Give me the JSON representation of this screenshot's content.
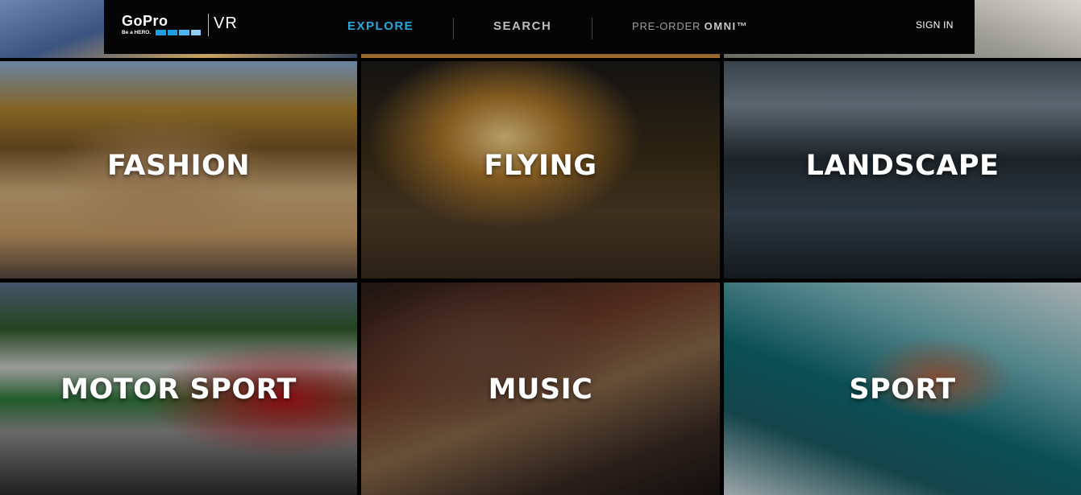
{
  "header": {
    "logo_word": "GoPro",
    "logo_tagline": "Be a HERO.",
    "logo_product": "VR",
    "nav": {
      "explore": "EXPLORE",
      "search": "SEARCH",
      "preorder_prefix": "PRE-ORDER",
      "preorder_product": "OMNI™"
    },
    "sign_in": "SIGN IN",
    "accent_color": "#26a8e0"
  },
  "tiles": [
    {
      "label": "FASHION"
    },
    {
      "label": "FLYING"
    },
    {
      "label": "LANDSCAPE"
    },
    {
      "label": "MOTOR SPORT"
    },
    {
      "label": "MUSIC"
    },
    {
      "label": "SPORT"
    }
  ]
}
